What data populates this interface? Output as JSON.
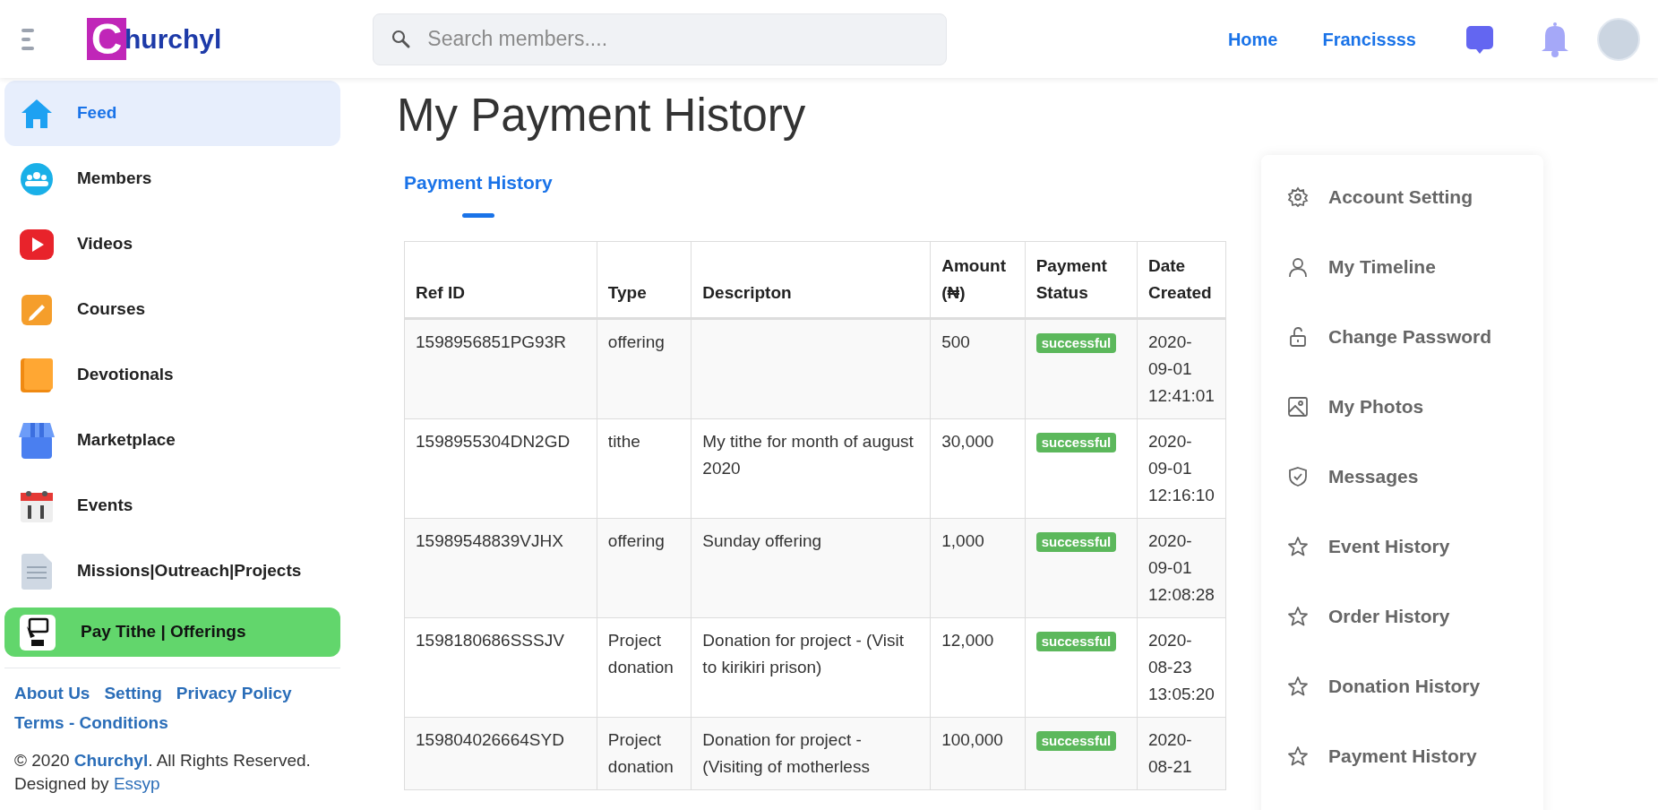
{
  "header": {
    "logo": {
      "initial": "C",
      "rest": "hurchyl"
    },
    "search": {
      "placeholder": "Search members...."
    },
    "nav_links": [
      "Home",
      "Francissss"
    ]
  },
  "sidebar": {
    "items": [
      {
        "label": "Feed",
        "selected": true,
        "kind": "link"
      },
      {
        "label": "Members",
        "selected": false,
        "kind": "link"
      },
      {
        "label": "Videos",
        "selected": false,
        "kind": "link"
      },
      {
        "label": "Courses",
        "selected": false,
        "kind": "link"
      },
      {
        "label": "Devotionals",
        "selected": false,
        "kind": "link"
      },
      {
        "label": "Marketplace",
        "selected": false,
        "kind": "link"
      },
      {
        "label": "Events",
        "selected": false,
        "kind": "link"
      },
      {
        "label": "Missions|Outreach|Projects",
        "selected": false,
        "kind": "link"
      },
      {
        "label": "Pay Tithe | Offerings",
        "selected": false,
        "kind": "action"
      }
    ],
    "footer_links": [
      "About Us",
      "Setting",
      "Privacy Policy",
      "Terms - Conditions"
    ],
    "copyright": {
      "prefix": "© 2020 ",
      "link": "Churchyl",
      "suffix": ". All Rights Reserved."
    },
    "designed_by": {
      "prefix": "Designed by ",
      "link": "Essyp"
    }
  },
  "page_title": "My Payment History",
  "tabs": [
    {
      "label": "Payment History",
      "selected": true
    }
  ],
  "table": {
    "columns": [
      "Ref ID",
      "Type",
      "Descripton",
      "Amount (₦)",
      "Payment Status",
      "Date Created"
    ],
    "rows": [
      {
        "ref": "1598956851PG93R",
        "type": "offering",
        "description": "",
        "amount": "500",
        "status": "successful",
        "date": "2020-09-01 12:41:01"
      },
      {
        "ref": "1598955304DN2GD",
        "type": "tithe",
        "description": "My tithe for month of august 2020",
        "amount": "30,000",
        "status": "successful",
        "date": "2020-09-01 12:16:10"
      },
      {
        "ref": "15989548839VJHX",
        "type": "offering",
        "description": "Sunday offering",
        "amount": "1,000",
        "status": "successful",
        "date": "2020-09-01 12:08:28"
      },
      {
        "ref": "1598180686SSSJV",
        "type": "Project donation",
        "description": "Donation for project - (Visit to kirikiri prison)",
        "amount": "12,000",
        "status": "successful",
        "date": "2020-08-23 13:05:20"
      },
      {
        "ref": "159804026664SYD",
        "type": "Project donation",
        "description": "Donation for project - (Visiting of motherless",
        "amount": "100,000",
        "status": "successful",
        "date": "2020-08-21"
      }
    ]
  },
  "account_menu": {
    "items": [
      "Account Setting",
      "My Timeline",
      "Change Password",
      "My Photos",
      "Messages",
      "Event History",
      "Order History",
      "Donation History",
      "Payment History"
    ]
  }
}
